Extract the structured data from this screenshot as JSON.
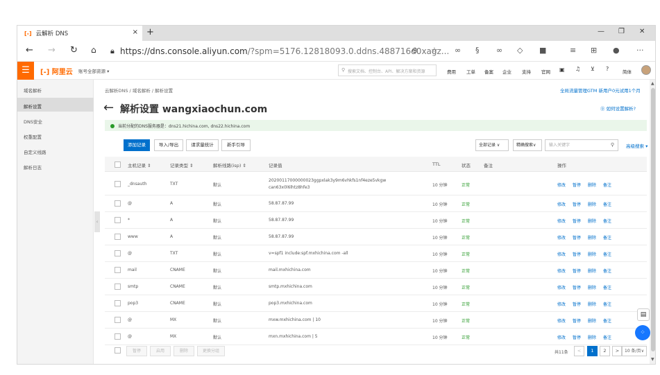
{
  "browser": {
    "tab_title": "云解析 DNS",
    "tab_logo": "[-]",
    "tab_close": "×",
    "new_tab": "+",
    "url_main": "https://dns.console.aliyun.com",
    "url_rest": "/?spm=5176.12818093.0.ddns.488716d0xagz...",
    "win_min": "—",
    "win_restore": "❐",
    "win_close": "✕"
  },
  "console": {
    "menu_icon": "☰",
    "brand": "[-] 阿里云",
    "resource_label": "账号全部资源 ▾",
    "search_placeholder": "搜索文档、控制台、API、解决方案和资源",
    "nav": [
      "费用",
      "工单",
      "备案",
      "企业",
      "支持",
      "官网"
    ],
    "lang": "简体"
  },
  "sidebar": {
    "items": [
      "域名解析",
      "解析设置",
      "DNS安全",
      "权重配置",
      "自定义线路",
      "解析日志"
    ],
    "active_index": 1
  },
  "page": {
    "breadcrumb": "云解析DNS  /  域名解析  /  解析设置",
    "gtm_link": "全局流量管理GTM 新用户0元试用1个月",
    "title": "解析设置 wangxiaochun.com",
    "help_link": "⓪ 如何设置解析?",
    "notice": "当前分配的DNS服务器是：dns21.hichina.com, dns22.hichina.com"
  },
  "toolbar": {
    "add": "添加记录",
    "import": "导入/导出",
    "stats": "请求量统计",
    "guide": "新手引导",
    "all_records": "全部记录 ∨",
    "exact": "精确搜索∨",
    "keyword_placeholder": "输入关键字",
    "advanced": "高级搜索 ▾"
  },
  "table": {
    "headers": [
      "主机记录 ⇕",
      "记录类型 ⇕",
      "解析线路(isp) ⇕",
      "记录值",
      "TTL",
      "状态",
      "备注",
      "操作"
    ],
    "rows": [
      {
        "host": "_dnsauth",
        "type": "TXT",
        "line": "默认",
        "value": "20200117000000023ggpxlak3y9m6vhkfs1nf4eze5vkgw",
        "value2": "can63x0l6lhtz8hfe3",
        "ttl": "10 分钟",
        "status": "正常"
      },
      {
        "host": "@",
        "type": "A",
        "line": "默认",
        "value": "58.87.87.99",
        "value2": "",
        "ttl": "10 分钟",
        "status": "正常"
      },
      {
        "host": "*",
        "type": "A",
        "line": "默认",
        "value": "58.87.87.99",
        "value2": "",
        "ttl": "10 分钟",
        "status": "正常"
      },
      {
        "host": "www",
        "type": "A",
        "line": "默认",
        "value": "58.87.87.99",
        "value2": "",
        "ttl": "10 分钟",
        "status": "正常"
      },
      {
        "host": "@",
        "type": "TXT",
        "line": "默认",
        "value": "v=spf1 include:spf.mxhichina.com -all",
        "value2": "",
        "ttl": "10 分钟",
        "status": "正常"
      },
      {
        "host": "mail",
        "type": "CNAME",
        "line": "默认",
        "value": "mail.mxhichina.com",
        "value2": "",
        "ttl": "10 分钟",
        "status": "正常"
      },
      {
        "host": "smtp",
        "type": "CNAME",
        "line": "默认",
        "value": "smtp.mxhichina.com",
        "value2": "",
        "ttl": "10 分钟",
        "status": "正常"
      },
      {
        "host": "pop3",
        "type": "CNAME",
        "line": "默认",
        "value": "pop3.mxhichina.com",
        "value2": "",
        "ttl": "10 分钟",
        "status": "正常"
      },
      {
        "host": "@",
        "type": "MX",
        "line": "默认",
        "value": "mxw.mxhichina.com | 10",
        "value2": "",
        "ttl": "10 分钟",
        "status": "正常"
      },
      {
        "host": "@",
        "type": "MX",
        "line": "默认",
        "value": "mxn.mxhichina.com | 5",
        "value2": "",
        "ttl": "10 分钟",
        "status": "正常"
      }
    ],
    "actions": [
      "修改",
      "暂停",
      "删除",
      "备注"
    ]
  },
  "footer": {
    "buttons": [
      "暂停",
      "启用",
      "删除",
      "更换分组"
    ],
    "total": "共11条",
    "prev": "<",
    "pages": [
      "1",
      "2"
    ],
    "next": ">",
    "page_size": "10 条/页∨"
  },
  "colors": {
    "accent": "#ff6a00",
    "primary": "#0070cc",
    "ok": "#2a9a2a"
  }
}
